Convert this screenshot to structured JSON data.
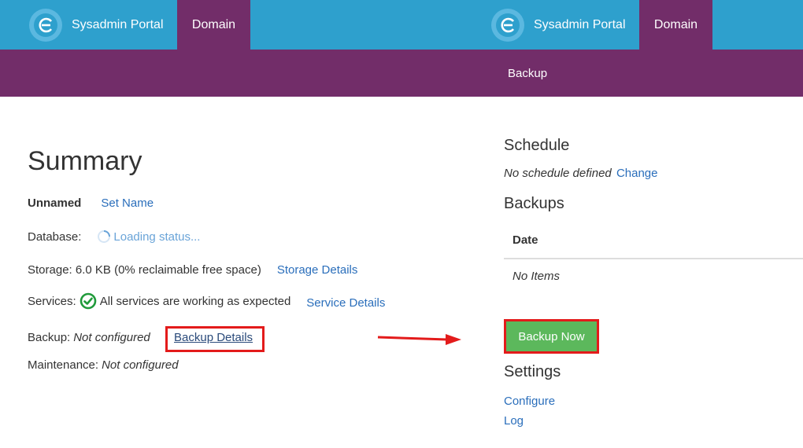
{
  "header": {
    "brand_name": "Sysadmin Portal",
    "domain_tab": "Domain",
    "sub_label": "Backup"
  },
  "summary": {
    "title": "Summary",
    "name_label": "Unnamed",
    "set_name_link": "Set Name",
    "database_label": "Database:",
    "database_status": "Loading status...",
    "storage_text": "Storage: 6.0 KB (0% reclaimable free space)",
    "storage_link": "Storage Details",
    "services_label": "Services:",
    "services_status": "All services are working as expected",
    "services_link": "Service Details",
    "backup_label": "Backup:",
    "backup_status": "Not configured",
    "backup_link": "Backup Details",
    "maintenance_label": "Maintenance:",
    "maintenance_status": "Not configured"
  },
  "backup_panel": {
    "schedule_title": "Schedule",
    "schedule_status": "No schedule defined",
    "schedule_change_link": "Change",
    "backups_title": "Backups",
    "table_columns": [
      "Date"
    ],
    "empty_text": "No Items",
    "backup_now_button": "Backup Now",
    "settings_title": "Settings",
    "configure_link": "Configure",
    "log_link": "Log"
  },
  "colors": {
    "header_blue": "#2ea0cd",
    "header_purple": "#722d69",
    "link_blue": "#2a6ebb",
    "success_green": "#5cb85c",
    "highlight_red": "#e31b1b"
  },
  "icons": [
    "portal-logo-icon",
    "loading-spinner-icon",
    "check-circle-icon",
    "arrow-right-icon"
  ]
}
